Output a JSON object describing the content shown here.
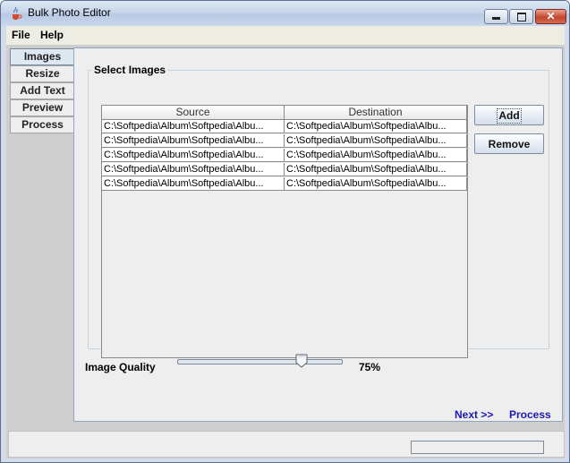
{
  "window": {
    "title": "Bulk Photo Editor"
  },
  "menu": [
    "File",
    "Help"
  ],
  "tabs": [
    "Images",
    "Resize",
    "Add Text",
    "Preview",
    "Process"
  ],
  "active_tab": "Images",
  "select_images": {
    "group_title": "Select Images",
    "columns": [
      "Source",
      "Destination"
    ],
    "rows": [
      [
        "C:\\Softpedia\\Album\\Softpedia\\Albu...",
        "C:\\Softpedia\\Album\\Softpedia\\Albu..."
      ],
      [
        "C:\\Softpedia\\Album\\Softpedia\\Albu...",
        "C:\\Softpedia\\Album\\Softpedia\\Albu..."
      ],
      [
        "C:\\Softpedia\\Album\\Softpedia\\Albu...",
        "C:\\Softpedia\\Album\\Softpedia\\Albu..."
      ],
      [
        "C:\\Softpedia\\Album\\Softpedia\\Albu...",
        "C:\\Softpedia\\Album\\Softpedia\\Albu..."
      ],
      [
        "C:\\Softpedia\\Album\\Softpedia\\Albu...",
        "C:\\Softpedia\\Album\\Softpedia\\Albu..."
      ]
    ],
    "add_button": "Add",
    "remove_button": "Remove"
  },
  "image_quality": {
    "label": "Image Quality",
    "value_text": "75%",
    "value": 0.75
  },
  "footer": {
    "next_link": "Next >>",
    "process_link": "Process"
  },
  "status": {
    "progress": 0
  },
  "icons": {
    "app": "java-cup-icon",
    "minimize": "minimize-icon",
    "maximize": "maximize-icon",
    "close": "close-icon"
  }
}
